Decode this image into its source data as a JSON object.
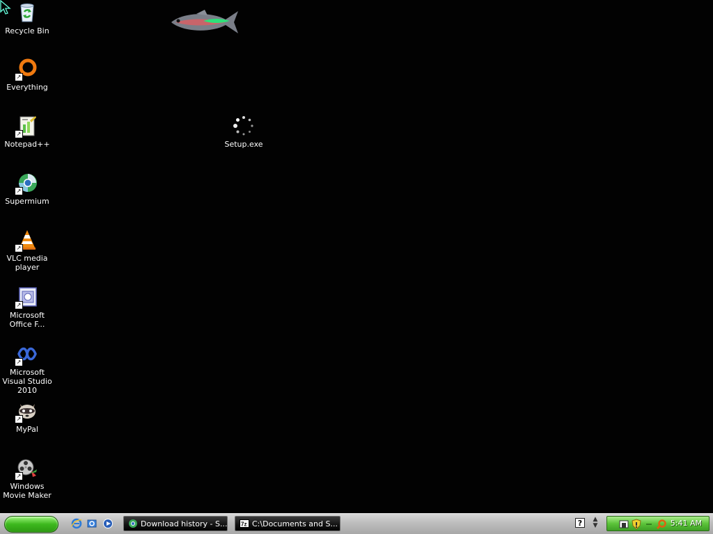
{
  "desktop": {
    "icons": [
      {
        "label": "Recycle Bin",
        "icon": "recycle-bin-icon"
      },
      {
        "label": "Everything",
        "icon": "everything-icon"
      },
      {
        "label": "Notepad++",
        "icon": "notepad-plus-plus-icon"
      },
      {
        "label": "Supermium",
        "icon": "supermium-icon"
      },
      {
        "label": "VLC media player",
        "icon": "vlc-cone-icon"
      },
      {
        "label": "Microsoft Office F...",
        "icon": "office-icon"
      },
      {
        "label": "Microsoft Visual Studio 2010",
        "icon": "visual-studio-icon"
      },
      {
        "label": "MyPal",
        "icon": "mypal-raccoon-icon"
      },
      {
        "label": "Windows Movie Maker",
        "icon": "movie-maker-icon"
      },
      {
        "label": "Setup.exe",
        "icon": "loading-spinner-icon"
      }
    ]
  },
  "taskbar": {
    "start_button": {
      "label": ""
    },
    "quick_launch": [
      "internet-explorer-icon",
      "outlook-express-icon",
      "media-player-icon"
    ],
    "tasks": [
      {
        "label": "Download history - S...",
        "icon": "supermium-icon"
      },
      {
        "label": "C:\\Documents and S...",
        "icon": "7zip-icon"
      }
    ],
    "tray": {
      "help_label": "?",
      "icons": [
        "network-icon",
        "security-shield-icon",
        "separator-icon",
        "search-icon"
      ],
      "clock": "5:41 AM"
    }
  },
  "colors": {
    "desktop_bg": "#020202",
    "start_green": "#3db81e",
    "taskbar_silver": "#bdbdbd",
    "task_button_black": "#111111"
  }
}
